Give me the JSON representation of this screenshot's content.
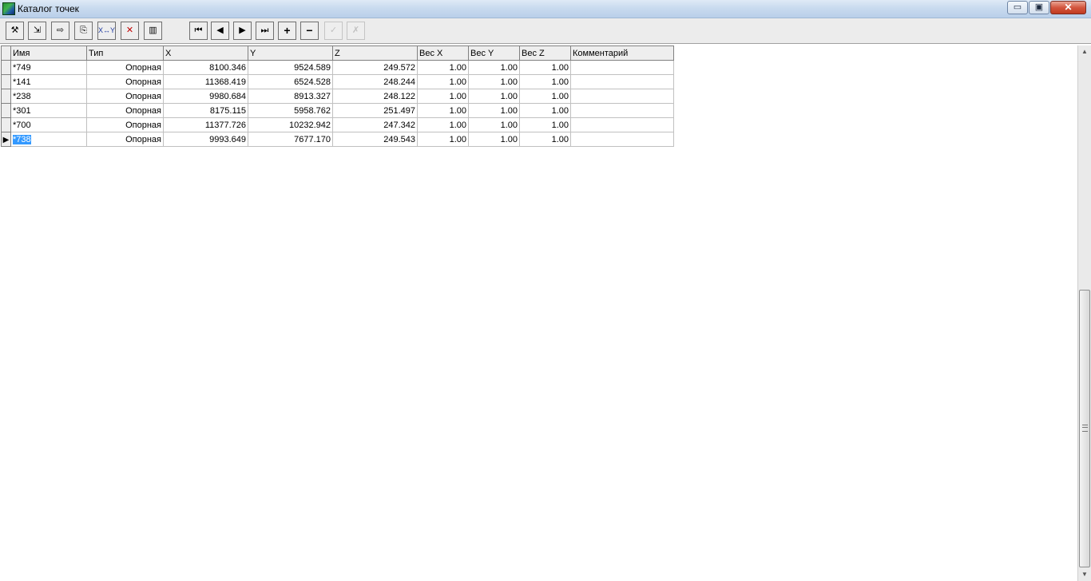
{
  "window": {
    "title": "Каталог точек",
    "controls": {
      "minimize": "▭",
      "maximize": "▣",
      "close": "✕"
    }
  },
  "toolbar": {
    "buttons": [
      {
        "icon": "tool-icon",
        "glyph": "⚒",
        "enabled": true
      },
      {
        "icon": "import-icon",
        "glyph": "⇲",
        "enabled": true
      },
      {
        "icon": "export-icon",
        "glyph": "⇨",
        "enabled": true
      },
      {
        "icon": "copy-icon",
        "glyph": "⎘",
        "enabled": true
      },
      {
        "icon": "swap-xy-icon",
        "label": "X↔Y",
        "enabled": true
      },
      {
        "icon": "delete-icon",
        "glyph": "✕",
        "enabled": true
      },
      {
        "icon": "chart-icon",
        "glyph": "▥",
        "enabled": true
      }
    ],
    "navigator": [
      {
        "icon": "first-record-icon",
        "glyph": "⏮",
        "enabled": true
      },
      {
        "icon": "prior-record-icon",
        "glyph": "◀",
        "enabled": true
      },
      {
        "icon": "next-record-icon",
        "glyph": "▶",
        "enabled": true
      },
      {
        "icon": "last-record-icon",
        "glyph": "⏭",
        "enabled": true
      },
      {
        "icon": "insert-record-icon",
        "glyph": "+",
        "enabled": true
      },
      {
        "icon": "delete-record-icon",
        "glyph": "−",
        "enabled": true
      },
      {
        "icon": "post-edit-icon",
        "glyph": "✓",
        "enabled": false
      },
      {
        "icon": "cancel-edit-icon",
        "glyph": "✗",
        "enabled": false
      }
    ]
  },
  "grid": {
    "columns": [
      "Имя",
      "Тип",
      "X",
      "Y",
      "Z",
      "Вес X",
      "Вес Y",
      "Вес Z",
      "Комментарий"
    ],
    "rows": [
      [
        "*749",
        "Опорная",
        "8100.346",
        "9524.589",
        "249.572",
        "1.00",
        "1.00",
        "1.00",
        ""
      ],
      [
        "*141",
        "Опорная",
        "11368.419",
        "6524.528",
        "248.244",
        "1.00",
        "1.00",
        "1.00",
        ""
      ],
      [
        "*238",
        "Опорная",
        "9980.684",
        "8913.327",
        "248.122",
        "1.00",
        "1.00",
        "1.00",
        ""
      ],
      [
        "*301",
        "Опорная",
        "8175.115",
        "5958.762",
        "251.497",
        "1.00",
        "1.00",
        "1.00",
        ""
      ],
      [
        "*700",
        "Опорная",
        "11377.726",
        "10232.942",
        "247.342",
        "1.00",
        "1.00",
        "1.00",
        ""
      ],
      [
        "*738",
        "Опорная",
        "9993.649",
        "7677.170",
        "249.543",
        "1.00",
        "1.00",
        "1.00",
        ""
      ]
    ],
    "current_row_marker": "▶",
    "selected_row": 5
  },
  "scrollbar": {
    "up_glyph": "▲",
    "down_glyph": "▼"
  }
}
